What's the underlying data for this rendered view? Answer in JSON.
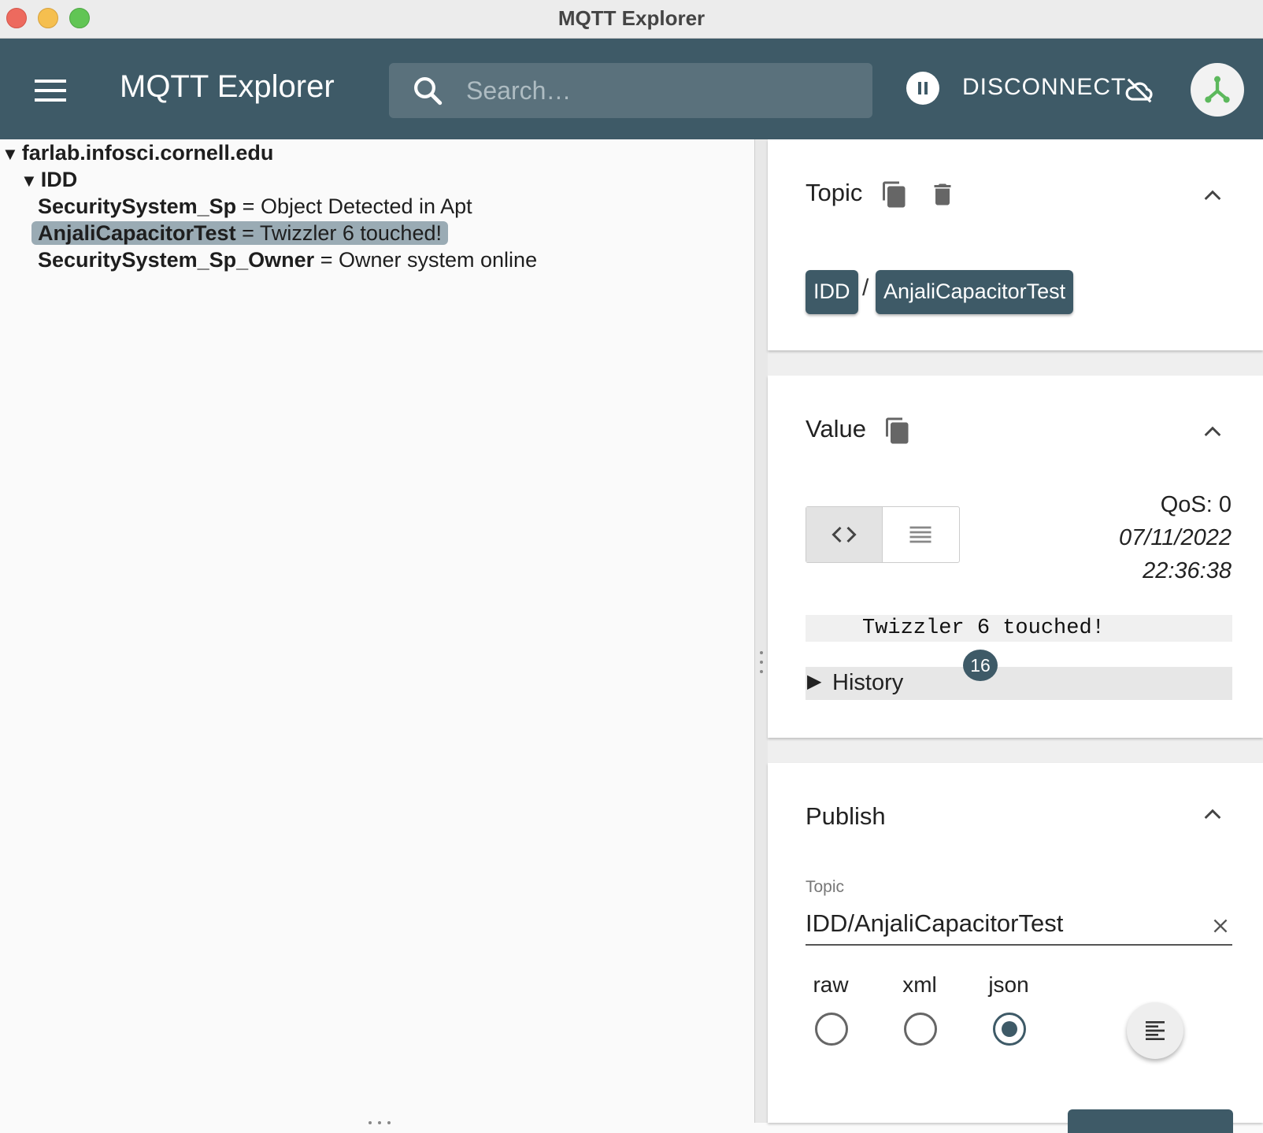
{
  "window": {
    "title": "MQTT Explorer"
  },
  "appbar": {
    "title": "MQTT Explorer",
    "search_placeholder": "Search…",
    "disconnect_label": "DISCONNECT"
  },
  "tree": {
    "host": "farlab.infosci.cornell.edu",
    "group": "IDD",
    "items": [
      {
        "key": "SecuritySystem_Sp",
        "value": "Object Detected in Apt",
        "selected": false
      },
      {
        "key": "AnjaliCapacitorTest",
        "value": "Twizzler 6 touched!",
        "selected": true
      },
      {
        "key": "SecuritySystem_Sp_Owner",
        "value": "Owner system online",
        "selected": false
      }
    ],
    "separator": "="
  },
  "topic_panel": {
    "title": "Topic",
    "breadcrumb": [
      "IDD",
      "AnjaliCapacitorTest"
    ],
    "separator": "/"
  },
  "value_panel": {
    "title": "Value",
    "qos": "QoS: 0",
    "date": "07/11/2022",
    "time": "22:36:38",
    "payload": "Twizzler 6 touched!",
    "history_label": "History",
    "history_count": "16"
  },
  "publish_panel": {
    "title": "Publish",
    "topic_label": "Topic",
    "topic_value": "IDD/AnjaliCapacitorTest",
    "formats": [
      "raw",
      "xml",
      "json"
    ],
    "selected_format": "json"
  },
  "colors": {
    "appbar": "#3e5a67",
    "selection": "#9aabb4",
    "avatar_icon": "#5cb85c"
  }
}
